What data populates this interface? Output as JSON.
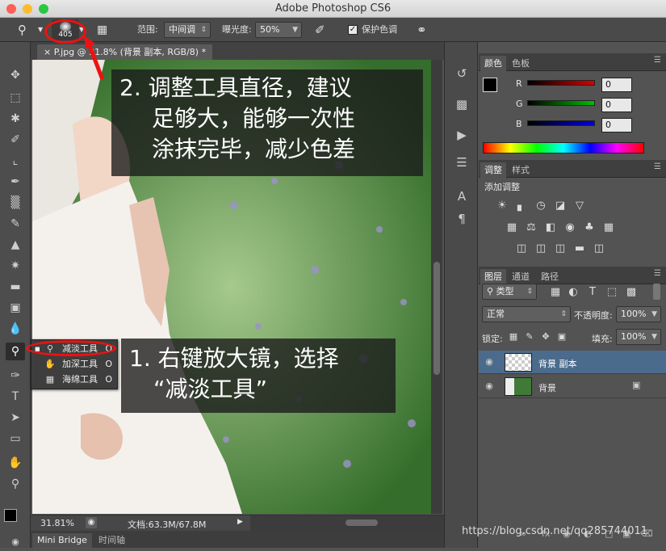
{
  "window": {
    "title": "Adobe Photoshop CS6"
  },
  "options": {
    "brush_size": "405",
    "range_label": "范围:",
    "range_value": "中间调",
    "exposure_label": "曝光度:",
    "exposure_value": "50%",
    "protect_tone_label": "保护色调"
  },
  "document": {
    "tab_title": "P.jpg @ 31.8% (背景 副本, RGB/8) *"
  },
  "status": {
    "zoom": "31.81%",
    "doc_size": "文档:63.3M/67.8M"
  },
  "bottom_tabs": [
    "Mini Bridge",
    "时间轴"
  ],
  "context_menu": [
    {
      "label": "减淡工具",
      "key": "O",
      "icon": "dodge-icon"
    },
    {
      "label": "加深工具",
      "key": "O",
      "icon": "burn-icon"
    },
    {
      "label": "海绵工具",
      "key": "O",
      "icon": "sponge-icon"
    }
  ],
  "annotations": {
    "step2": [
      "2. 调整工具直径，建议",
      "足够大，能够一次性",
      "涂抹完毕，减少色差"
    ],
    "step1": [
      "1. 右键放大镜，选择",
      "“减淡工具”"
    ]
  },
  "color_panel": {
    "tabs": [
      "颜色",
      "色板"
    ],
    "channels": [
      {
        "label": "R",
        "value": "0",
        "color": "#d80000"
      },
      {
        "label": "G",
        "value": "0",
        "color": "#00c000"
      },
      {
        "label": "B",
        "value": "0",
        "color": "#0000e0"
      }
    ]
  },
  "adjust_panel": {
    "tabs": [
      "调整",
      "样式"
    ],
    "add_label": "添加调整"
  },
  "layers_panel": {
    "tabs": [
      "图层",
      "通道",
      "路径"
    ],
    "kind_label": "类型",
    "blend_mode": "正常",
    "opacity_label": "不透明度:",
    "opacity_value": "100%",
    "lock_label": "锁定:",
    "fill_label": "填充:",
    "fill_value": "100%",
    "layers": [
      {
        "name": "背景 副本",
        "selected": true
      },
      {
        "name": "背景",
        "locked": true
      }
    ]
  },
  "watermark": "https://blog.csdn.net/qq285744011",
  "colors": {
    "accent_red": "#e11111",
    "selected_layer": "#4b6b8c",
    "panel_bg": "#535353"
  }
}
